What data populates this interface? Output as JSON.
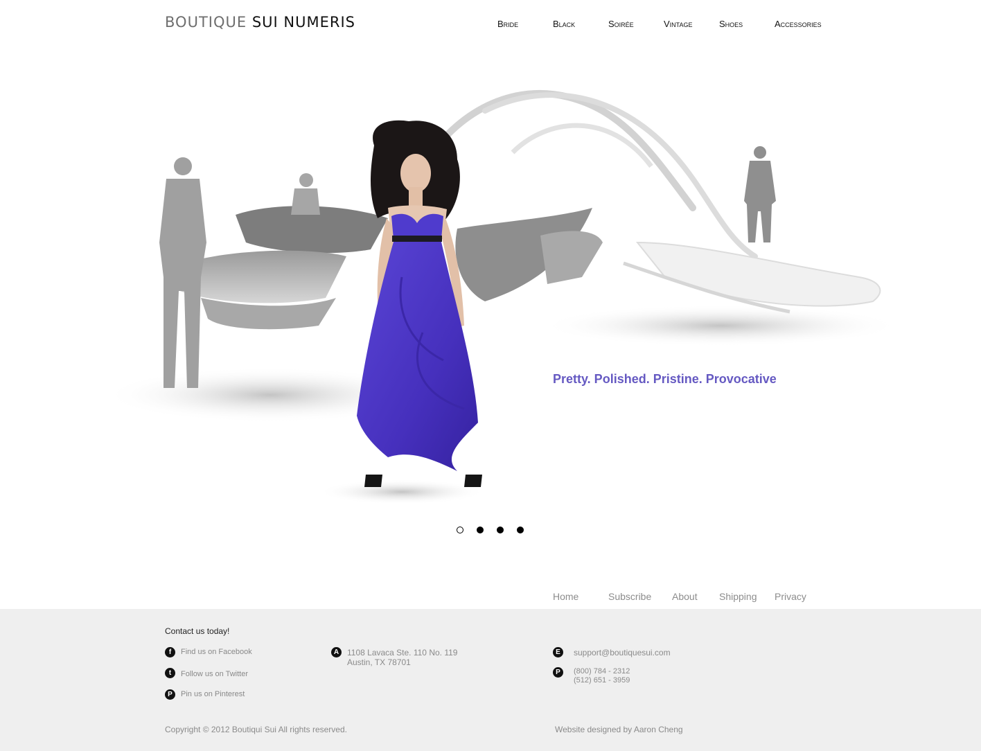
{
  "brand": {
    "part1": "BOUTIQUE",
    "part2": "SUI NUMERIS"
  },
  "nav": [
    "Bride",
    "Black",
    "Soirée",
    "Vintage",
    "Shoes",
    "Accessories"
  ],
  "hero": {
    "tagline": "Pretty. Polished. Pristine. Provocative",
    "tagline_color": "#6559c2",
    "dress_color": "#4a32c0"
  },
  "carousel": {
    "slides": 4,
    "active_index": 0
  },
  "footer_links": [
    "Home",
    "Subscribe",
    "About",
    "Shipping",
    "Privacy"
  ],
  "footer": {
    "background": "#efefef",
    "contact_title": "Contact us today!",
    "social": [
      {
        "icon": "facebook-icon",
        "glyph": "f",
        "label": "Find us on Facebook"
      },
      {
        "icon": "twitter-icon",
        "glyph": "t",
        "label": "Follow us on Twitter"
      },
      {
        "icon": "pinterest-icon",
        "glyph": "P",
        "label": "Pin us on Pinterest"
      }
    ],
    "address": {
      "icon": "address-icon",
      "glyph": "A",
      "line1": "1108 Lavaca Ste. 110 No. 119",
      "line2": "Austin, TX 78701"
    },
    "email": {
      "icon": "email-icon",
      "glyph": "E",
      "value": "support@boutiquesui.com"
    },
    "phone": {
      "icon": "phone-icon",
      "glyph": "P",
      "line1": "(800) 784 - 2312",
      "line2": "(512) 651 - 3959"
    },
    "copyright": "Copyright © 2012 Boutiqui Sui All rights reserved.",
    "credit": "Website designed by  Aaron Cheng"
  }
}
